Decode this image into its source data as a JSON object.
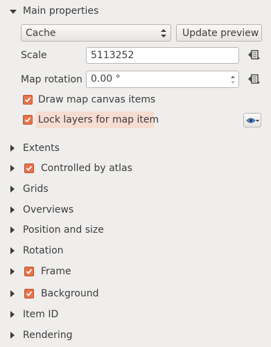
{
  "main_properties": {
    "title": "Main properties",
    "preview_mode": "Cache",
    "update_preview_label": "Update preview",
    "scale_label": "Scale",
    "scale_value": "5113252",
    "rotation_label": "Map rotation",
    "rotation_value": "0.00 °",
    "draw_canvas_label": "Draw map canvas items",
    "draw_canvas_checked": true,
    "lock_layers_label": "Lock layers for map item",
    "lock_layers_checked": true
  },
  "sections": [
    {
      "label": "Extents",
      "checkbox": false
    },
    {
      "label": "Controlled by atlas",
      "checkbox": true
    },
    {
      "label": "Grids",
      "checkbox": false
    },
    {
      "label": "Overviews",
      "checkbox": false
    },
    {
      "label": "Position and size",
      "checkbox": false
    },
    {
      "label": "Rotation",
      "checkbox": false
    },
    {
      "label": "Frame",
      "checkbox": true
    },
    {
      "label": "Background",
      "checkbox": true
    },
    {
      "label": "Item ID",
      "checkbox": false
    },
    {
      "label": "Rendering",
      "checkbox": false
    }
  ],
  "colors": {
    "background": "#efeeed",
    "checkbox": "#e7734a",
    "highlight": "#f7dcd2"
  }
}
